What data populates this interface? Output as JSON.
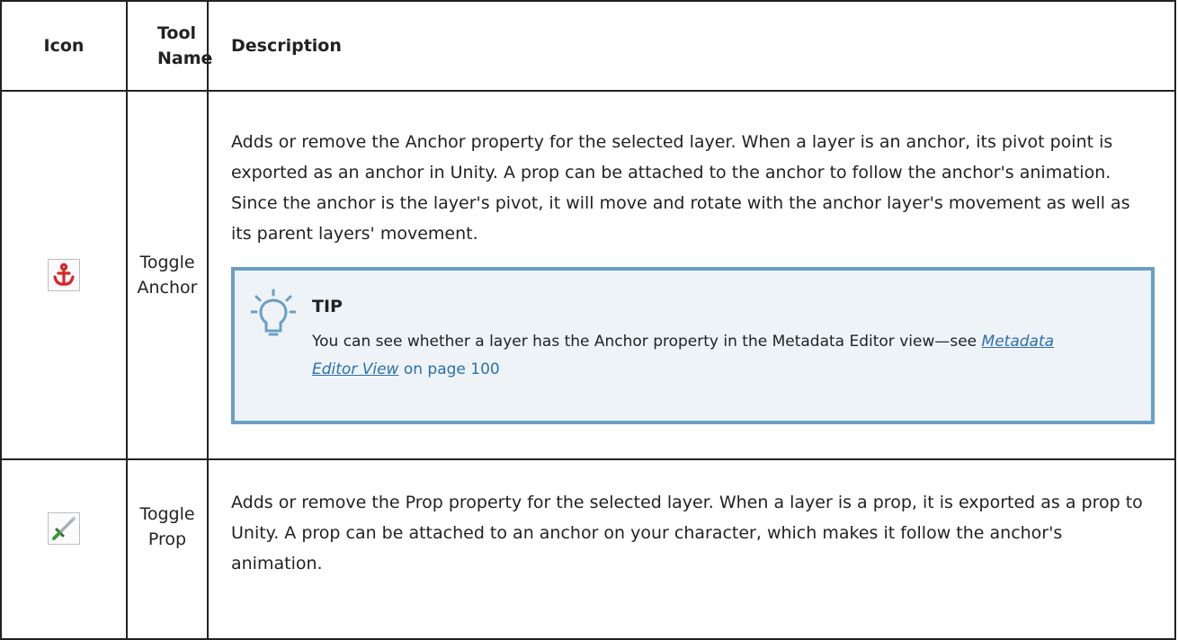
{
  "table": {
    "headers": {
      "icon": "Icon",
      "tool_name_line1": "Tool",
      "tool_name_line2": "Name",
      "description": "Description"
    },
    "rows": [
      {
        "icon": "anchor-icon",
        "name_line1": "Toggle",
        "name_line2": "Anchor",
        "description": "Adds or remove the Anchor property for the selected layer. When a layer is an anchor, its pivot point is exported as an anchor in Unity. A prop can be attached to the anchor to follow the anchor's animation. Since the anchor is the layer's pivot, it will move and rotate with the anchor layer's movement as well as its parent layers' movement.",
        "tip": {
          "icon": "lightbulb-icon",
          "title": "TIP",
          "text": "You can see whether a layer has the Anchor property in the Metadata Editor view—see ",
          "link": "Metadata Editor View",
          "page_ref": " on page 100"
        }
      },
      {
        "icon": "sword-icon",
        "name_line1": "Toggle",
        "name_line2": "Prop",
        "description": "Adds or remove the Prop property for the selected layer. When a layer is a prop, it is exported as a prop to Unity. A prop can be attached to an anchor on your character, which makes it follow the anchor's animation."
      }
    ]
  },
  "colors": {
    "border": "#222222",
    "tip_border": "#6a9fc6",
    "tip_background": "#eef3f7",
    "link": "#2d6fa8",
    "anchor_icon": "#d8262c",
    "sword_handle": "#3a9a3a"
  }
}
